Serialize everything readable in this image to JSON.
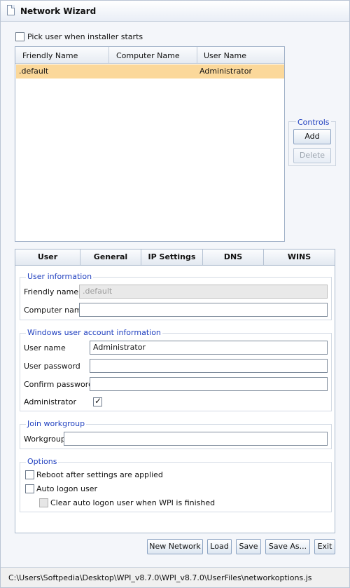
{
  "window": {
    "title": "Network Wizard"
  },
  "pick_user": {
    "label": "Pick user when installer starts",
    "checked": false
  },
  "users_table": {
    "columns": [
      "Friendly Name",
      "Computer Name",
      "User Name"
    ],
    "rows": [
      {
        "friendly_name": ".default",
        "computer_name": "",
        "user_name": "Administrator",
        "selected": true
      }
    ]
  },
  "controls": {
    "legend": "Controls",
    "add_label": "Add",
    "delete_label": "Delete"
  },
  "tabs": [
    {
      "label": "User",
      "active": true
    },
    {
      "label": "General"
    },
    {
      "label": "IP Settings"
    },
    {
      "label": "DNS"
    },
    {
      "label": "WINS"
    }
  ],
  "user_information": {
    "legend": "User information",
    "friendly_name_label": "Friendly name",
    "friendly_name_value": ".default",
    "computer_name_label": "Computer name",
    "computer_name_value": ""
  },
  "account_information": {
    "legend": "Windows user account information",
    "user_name_label": "User name",
    "user_name_value": "Administrator",
    "user_password_label": "User password",
    "user_password_value": "",
    "confirm_password_label": "Confirm password",
    "confirm_password_value": "",
    "administrator_label": "Administrator",
    "administrator_checked": true
  },
  "workgroup": {
    "legend": "Join workgroup",
    "label": "Workgroup",
    "value": ""
  },
  "options": {
    "legend": "Options",
    "reboot_label": "Reboot after settings are applied",
    "auto_logon_label": "Auto logon user",
    "clear_auto_logon_label": "Clear auto logon user when WPI is finished"
  },
  "footer_buttons": {
    "new_network": "New Network",
    "load": "Load",
    "save": "Save",
    "save_as": "Save As...",
    "exit": "Exit"
  },
  "status_bar": {
    "path": "C:\\Users\\Softpedia\\Desktop\\WPI_v8.7.0\\WPI_v8.7.0\\UserFiles\\networkoptions.js"
  }
}
